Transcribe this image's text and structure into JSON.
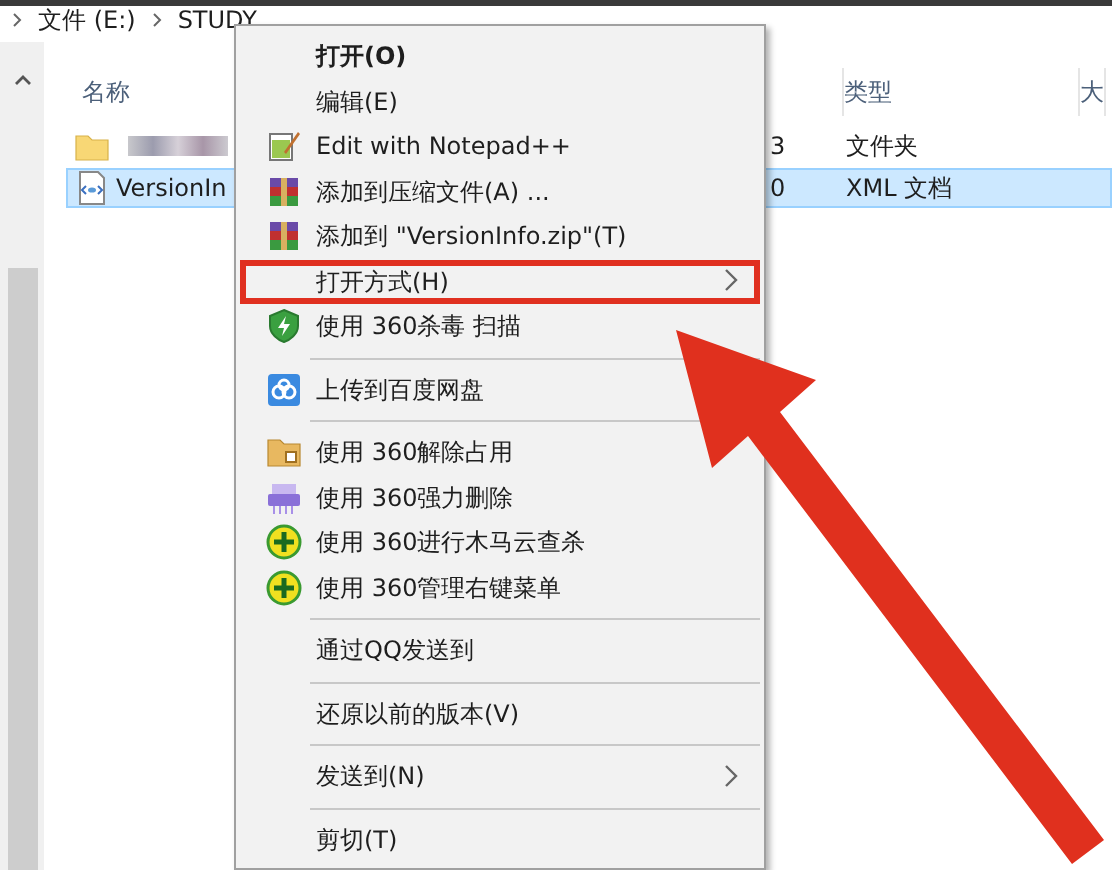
{
  "breadcrumb": [
    "文件 (E:)",
    "STUDY"
  ],
  "columns": [
    {
      "label": "名称"
    },
    {
      "label": "类型"
    },
    {
      "label": "大"
    }
  ],
  "rows": [
    {
      "kind": "folder",
      "name": "",
      "date_tail": "3",
      "type": "文件夹",
      "selected": false
    },
    {
      "kind": "xml",
      "name": "VersionIn",
      "date_tail": "0",
      "type": "XML 文档",
      "selected": true
    }
  ],
  "menu": [
    {
      "kind": "plain",
      "label": "打开(O)",
      "bold": true,
      "submenu": false,
      "highlighted": false
    },
    {
      "kind": "plain",
      "label": "编辑(E)",
      "bold": false,
      "submenu": false,
      "highlighted": false
    },
    {
      "kind": "notepad",
      "label": "Edit with Notepad++",
      "bold": false,
      "submenu": false,
      "highlighted": false
    },
    {
      "kind": "archive",
      "label": "添加到压缩文件(A) ...",
      "bold": false,
      "submenu": false,
      "highlighted": false
    },
    {
      "kind": "archive",
      "label": "添加到 \"VersionInfo.zip\"(T)",
      "bold": false,
      "submenu": false,
      "highlighted": false
    },
    {
      "kind": "plain",
      "label": "打开方式(H)",
      "bold": false,
      "submenu": true,
      "highlighted": true
    },
    {
      "kind": "shield",
      "label": "使用 360杀毒 扫描",
      "bold": false,
      "submenu": false,
      "highlighted": false
    },
    {
      "kind": "separator"
    },
    {
      "kind": "cloud",
      "label": "上传到百度网盘",
      "bold": false,
      "submenu": false,
      "highlighted": false
    },
    {
      "kind": "separator"
    },
    {
      "kind": "lockfolder",
      "label": "使用 360解除占用",
      "bold": false,
      "submenu": false,
      "highlighted": false
    },
    {
      "kind": "shredder",
      "label": "使用 360强力删除",
      "bold": false,
      "submenu": false,
      "highlighted": false
    },
    {
      "kind": "plus",
      "label": "使用 360进行木马云查杀",
      "bold": false,
      "submenu": false,
      "highlighted": false
    },
    {
      "kind": "plus",
      "label": "使用 360管理右键菜单",
      "bold": false,
      "submenu": false,
      "highlighted": false
    },
    {
      "kind": "separator"
    },
    {
      "kind": "plain",
      "label": "通过QQ发送到",
      "bold": false,
      "submenu": false,
      "highlighted": false
    },
    {
      "kind": "separator"
    },
    {
      "kind": "plain",
      "label": "还原以前的版本(V)",
      "bold": false,
      "submenu": false,
      "highlighted": false
    },
    {
      "kind": "separator"
    },
    {
      "kind": "plain",
      "label": "发送到(N)",
      "bold": false,
      "submenu": true,
      "highlighted": false
    },
    {
      "kind": "separator"
    },
    {
      "kind": "plain",
      "label": "剪切(T)",
      "bold": false,
      "submenu": false,
      "highlighted": false
    }
  ]
}
